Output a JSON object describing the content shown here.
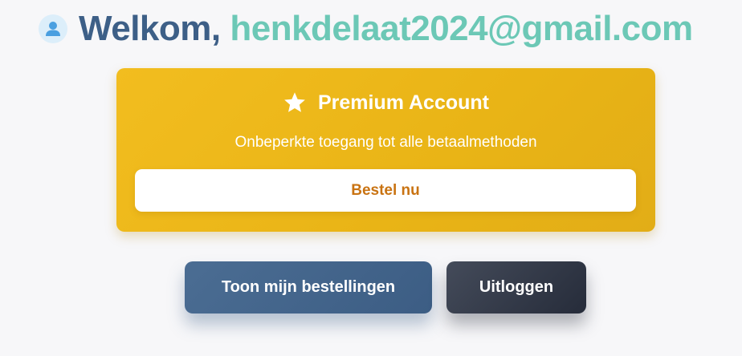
{
  "welcome": {
    "prefix": "Welkom,",
    "email": "henkdelaat2024@gmail.com",
    "icon": "user-icon"
  },
  "premium": {
    "title": "Premium Account",
    "subtitle": "Onbeperkte toegang tot alle betaalmethoden",
    "icon": "star-icon",
    "button_label": "Bestel nu"
  },
  "actions": {
    "orders_label": "Toon mijn bestellingen",
    "logout_label": "Uitloggen"
  },
  "colors": {
    "welcome_prefix": "#3d5f87",
    "welcome_email": "#6cc8b6",
    "premium_bg": "#eeb81b",
    "order_button_text": "#c97312",
    "orders_button_bg": "#4b6d93",
    "logout_button_bg": "#2f3544"
  }
}
